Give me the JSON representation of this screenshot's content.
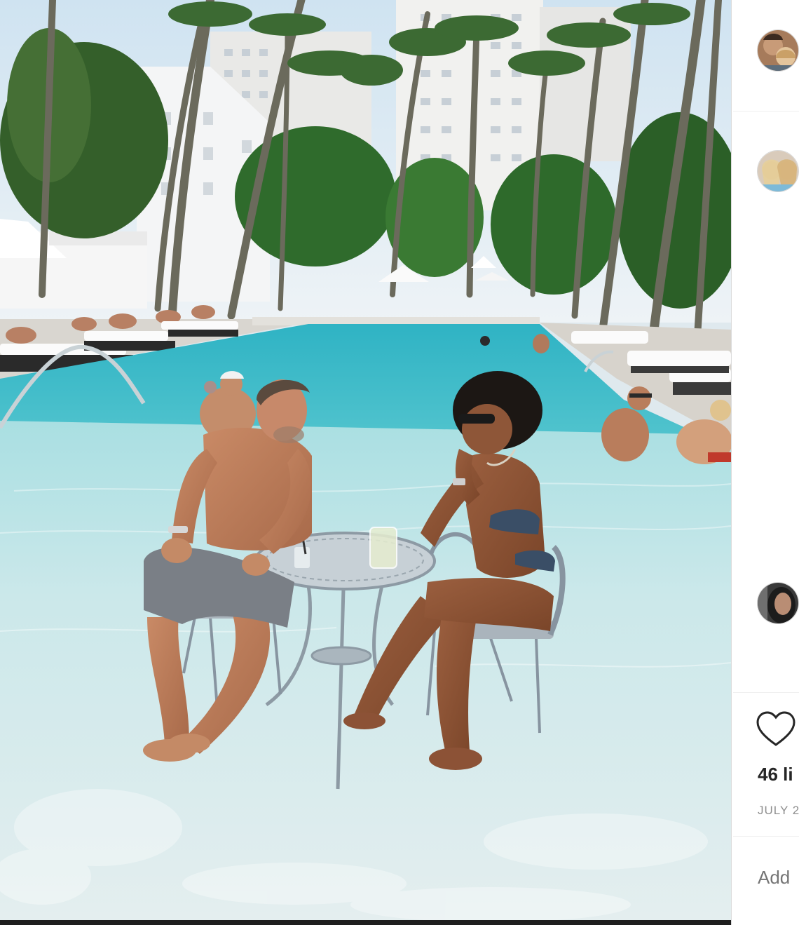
{
  "post": {
    "photo": {
      "icon": "pool-photo"
    }
  },
  "sidebar": {
    "avatars": [
      {
        "icon": "avatar-couple"
      },
      {
        "icon": "avatar-women"
      },
      {
        "icon": "avatar-woman"
      }
    ],
    "like_icon": "heart-icon",
    "likes_text": "46 li",
    "date_text": "JULY 2",
    "comment_placeholder": "Add"
  }
}
